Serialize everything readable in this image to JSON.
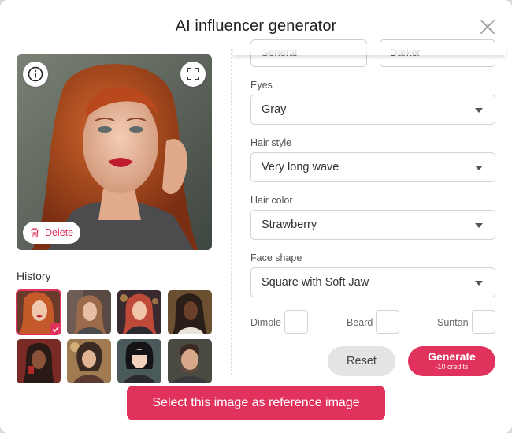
{
  "modal": {
    "title": "AI influencer generator"
  },
  "preview": {
    "delete_label": "Delete"
  },
  "history": {
    "label": "History",
    "thumbs": [
      {
        "bg": "#6a3a2a",
        "fg": "#c45a2a"
      },
      {
        "bg": "#5a4a44",
        "fg": "#9a6a4a"
      },
      {
        "bg": "#3a2a30",
        "fg": "#c04a3a"
      },
      {
        "bg": "#4a3220",
        "fg": "#5a3a26"
      },
      {
        "bg": "#7a2a24",
        "fg": "#4a2a1e"
      },
      {
        "bg": "#7a5a40",
        "fg": "#3a2a22"
      },
      {
        "bg": "#3a4a4a",
        "fg": "#1e1e22"
      },
      {
        "bg": "#4a4a42",
        "fg": "#6a4a3a"
      }
    ]
  },
  "partial_fields": {
    "left": "General",
    "right": "Darker"
  },
  "fields": {
    "eyes": {
      "label": "Eyes",
      "value": "Gray"
    },
    "hair_style": {
      "label": "Hair style",
      "value": "Very long wave"
    },
    "hair_color": {
      "label": "Hair color",
      "value": "Strawberry"
    },
    "face_shape": {
      "label": "Face shape",
      "value": "Square with Soft Jaw"
    }
  },
  "checkboxes": {
    "dimple": "Dimple",
    "beard": "Beard",
    "suntan": "Suntan"
  },
  "buttons": {
    "reset": "Reset",
    "generate": "Generate",
    "generate_cost": "-10 credits",
    "select_reference": "Select this image as reference image"
  },
  "colors": {
    "accent": "#e0325d",
    "reset_bg": "#e4e4e4"
  }
}
